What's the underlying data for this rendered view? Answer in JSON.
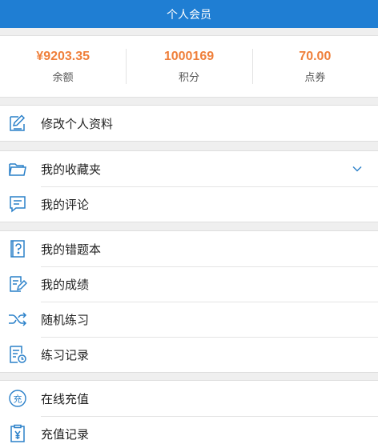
{
  "header": {
    "title": "个人会员"
  },
  "stats": [
    {
      "value": "¥9203.35",
      "label": "余额"
    },
    {
      "value": "1000169",
      "label": "积分"
    },
    {
      "value": "70.00",
      "label": "点券"
    }
  ],
  "menu": {
    "edit_profile": "修改个人资料",
    "favorites": "我的收藏夹",
    "comments": "我的评论",
    "wrong_questions": "我的错题本",
    "scores": "我的成绩",
    "random_practice": "随机练习",
    "practice_records": "练习记录",
    "online_recharge": "在线充值",
    "recharge_records": "充值记录"
  },
  "colors": {
    "header_bg": "#1f7ed3",
    "icon_blue": "#2a80c9",
    "stat_orange": "#ef7f3a"
  },
  "icons": {
    "edit_profile": "edit-icon",
    "favorites": "folder-icon",
    "comments": "comment-icon",
    "wrong_questions": "question-book-icon",
    "scores": "score-edit-icon",
    "random_practice": "shuffle-icon",
    "practice_records": "record-clock-icon",
    "online_recharge": "recharge-icon",
    "recharge_records": "clipboard-yen-icon"
  }
}
